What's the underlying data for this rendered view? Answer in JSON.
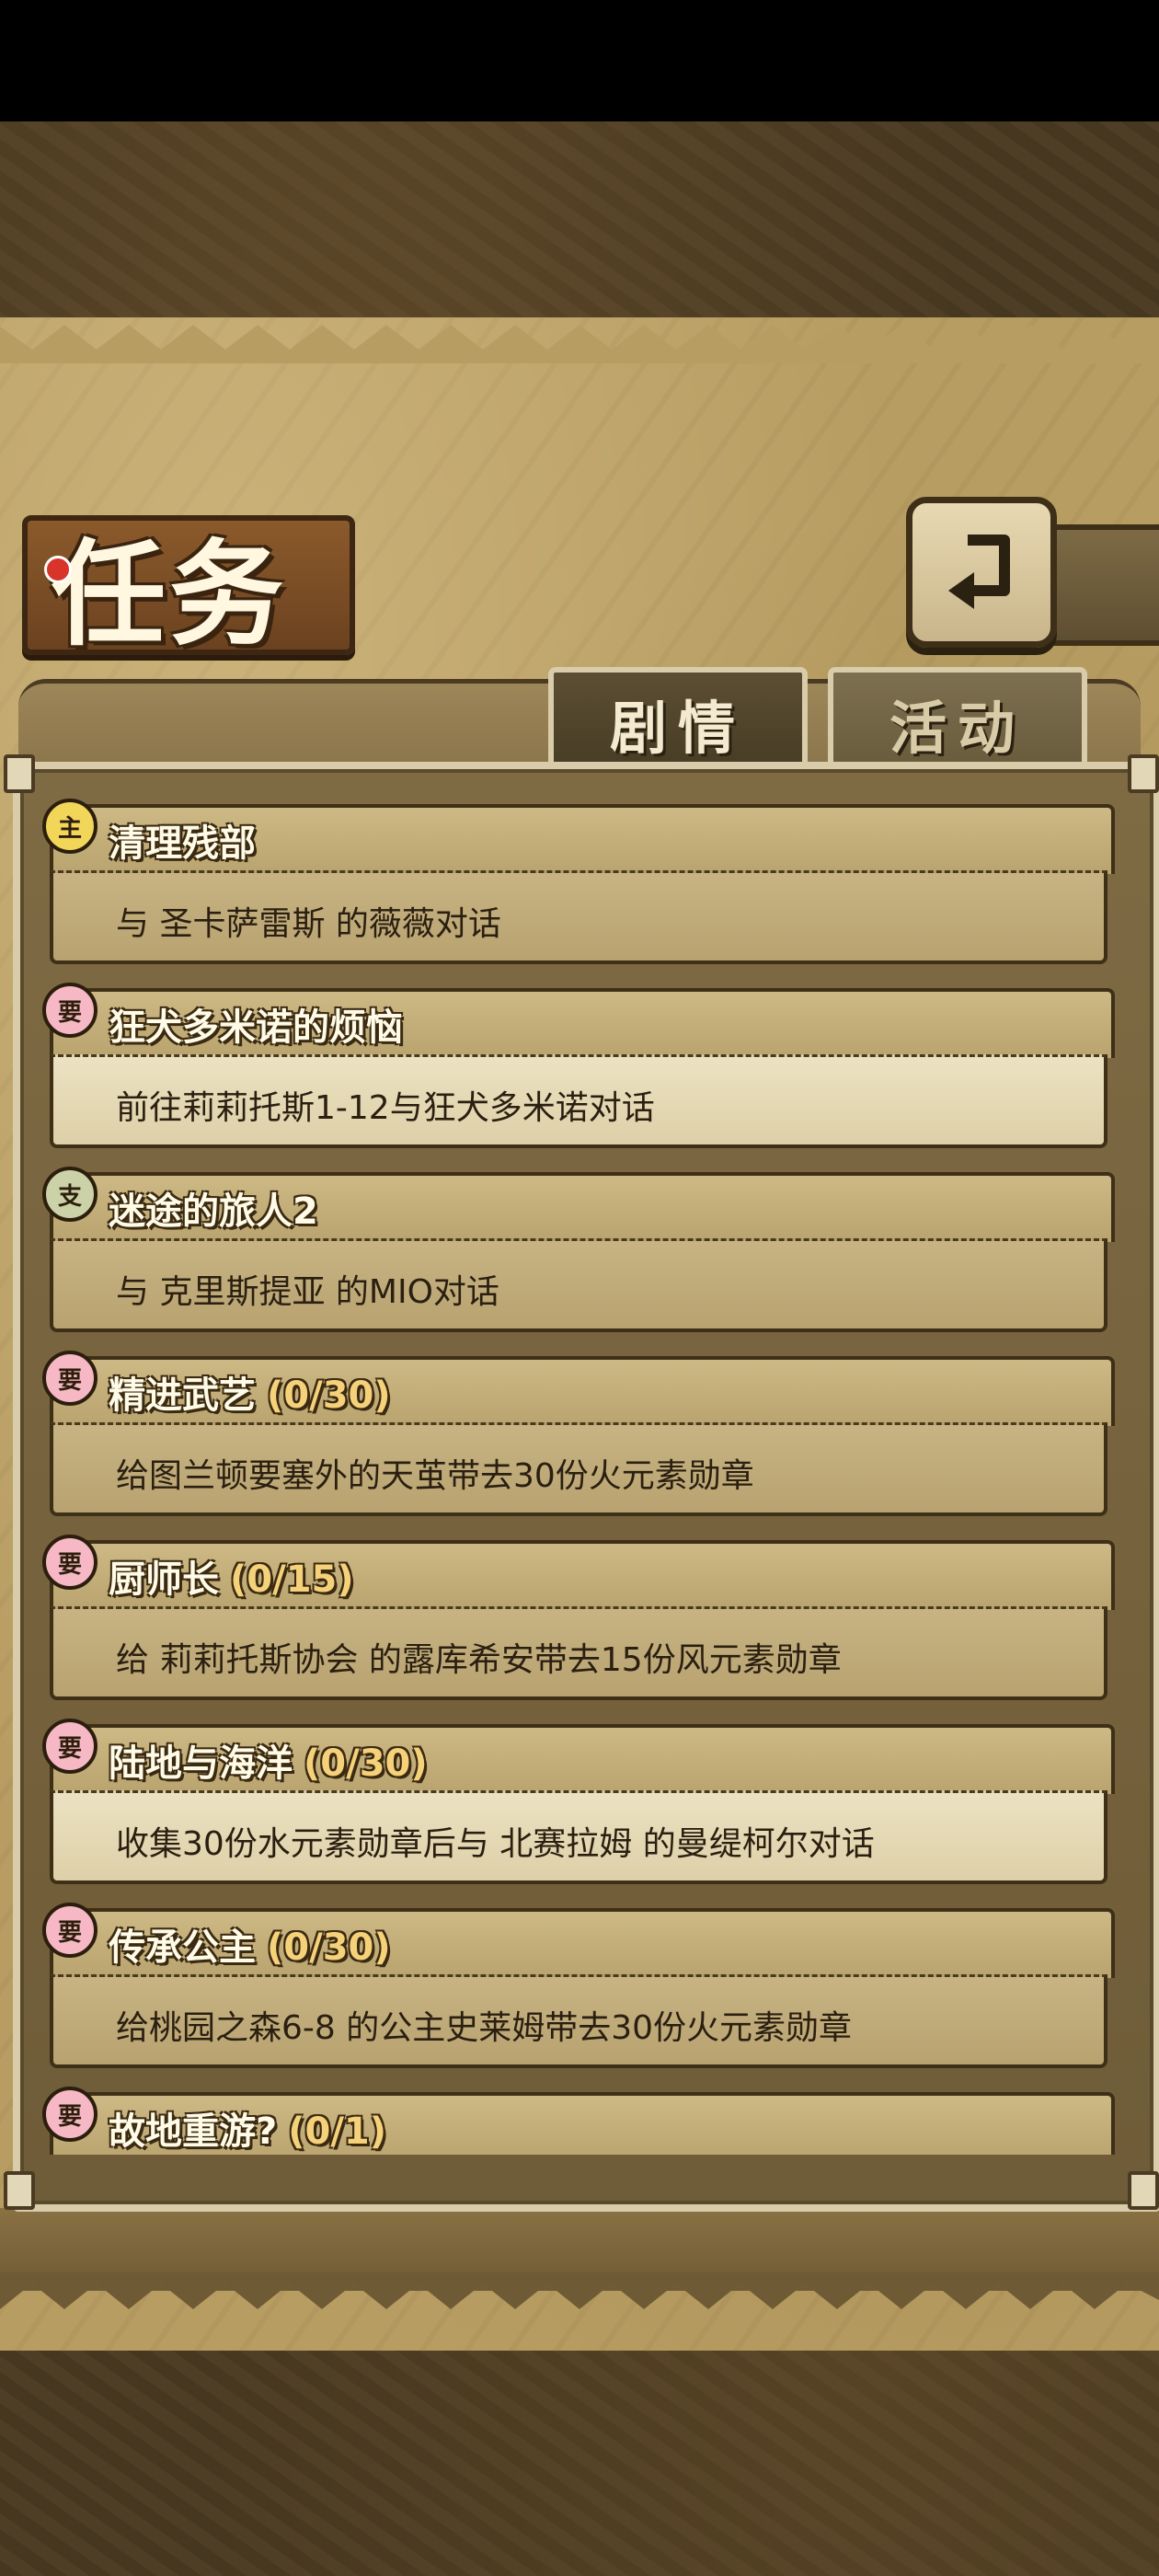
{
  "header": {
    "title": "任务",
    "back_icon": "back-arrow-icon"
  },
  "tabs": [
    {
      "label": "剧情",
      "active": true
    },
    {
      "label": "活动",
      "active": false
    }
  ],
  "quests": [
    {
      "badge": "主",
      "badge_type": "main",
      "title": "清理残部",
      "progress": "",
      "desc": "与 圣卡萨雷斯 的薇薇对话",
      "highlight": false
    },
    {
      "badge": "要",
      "badge_type": "req",
      "title": "狂犬多米诺的烦恼",
      "progress": "",
      "desc": "前往莉莉托斯1-12与狂犬多米诺对话",
      "highlight": true
    },
    {
      "badge": "支",
      "badge_type": "side",
      "title": "迷途的旅人2",
      "progress": "",
      "desc": "与 克里斯提亚 的MIO对话",
      "highlight": false
    },
    {
      "badge": "要",
      "badge_type": "req",
      "title": "精进武艺",
      "progress": "(0/30)",
      "desc": "给图兰顿要塞外的天茧带去30份火元素勋章",
      "highlight": false
    },
    {
      "badge": "要",
      "badge_type": "req",
      "title": "厨师长",
      "progress": "(0/15)",
      "desc": "给 莉莉托斯协会 的露库希安带去15份风元素勋章",
      "highlight": false
    },
    {
      "badge": "要",
      "badge_type": "req",
      "title": "陆地与海洋",
      "progress": "(0/30)",
      "desc": "收集30份水元素勋章后与 北赛拉姆 的曼缇柯尔对话",
      "highlight": true
    },
    {
      "badge": "要",
      "badge_type": "req",
      "title": "传承公主",
      "progress": "(0/30)",
      "desc": "给桃园之森6-8 的公主史莱姆带去30份火元素勋章",
      "highlight": false
    },
    {
      "badge": "要",
      "badge_type": "req",
      "title": "故地重游?",
      "progress": "(0/1)",
      "desc": "",
      "highlight": false
    }
  ]
}
